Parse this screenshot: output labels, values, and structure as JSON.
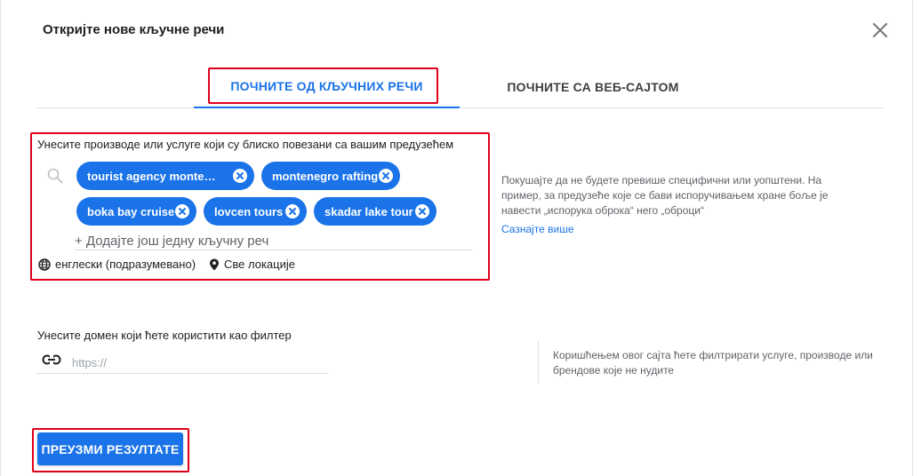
{
  "dialog": {
    "title": "Откријте нове кључне речи"
  },
  "tabs": [
    {
      "label": "ПОЧНИТЕ ОД КЉУЧНИХ РЕЧИ",
      "active": true
    },
    {
      "label": "ПОЧНИТЕ СА ВЕБ-САЈТОМ",
      "active": false
    }
  ],
  "keywords": {
    "label": "Унесите производе или услуге који су блиско повезани са вашим предузећем",
    "chips": [
      "tourist agency monteneg…",
      "montenegro rafting",
      "boka bay cruise",
      "lovcen tours",
      "skadar lake tour"
    ],
    "add_placeholder": "+ Додајте још једну кључну реч",
    "language": "енглески (подразумевано)",
    "location": "Све локације",
    "hint": "Покушајте да не будете превише специфични или уопштени. На пример, за предузеће које се бави испоручивањем хране боље је навести „испорука оброка“ него „оброци“",
    "learn_more": "Сазнајте више"
  },
  "domain": {
    "label": "Унесите домен који ћете користити као филтер",
    "placeholder": "https://",
    "hint": "Коришћењем овог сајта ћете филтрирати услуге, производе или брендове које не нудите"
  },
  "actions": {
    "submit_label": "ПРЕУЗМИ РЕЗУЛТАТЕ"
  },
  "colors": {
    "accent": "#1a73e8",
    "highlight": "#e0001b"
  },
  "icons": {
    "close": "close-icon",
    "search": "search-icon",
    "chip_remove": "cancel-circle-icon",
    "language": "globe-icon",
    "location": "location-pin-icon",
    "link": "link-icon"
  }
}
